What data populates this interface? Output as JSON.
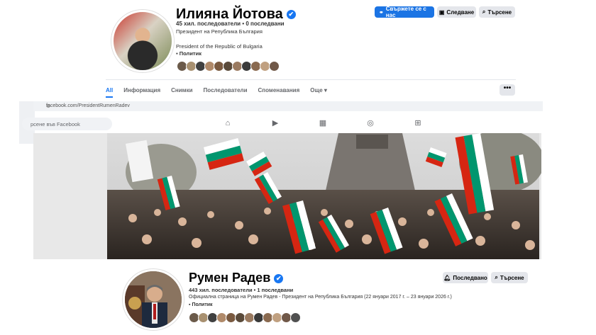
{
  "top_profile": {
    "name": "Илияна Йотова",
    "verified_mark": "✔",
    "stats": "45 хил. последователи • 0 последвани",
    "subtitle": "Президент на Република България",
    "description_en": "President of the Republic of Bulgaria",
    "category": "Политик",
    "buttons": {
      "contact": "Свържете се с нас",
      "follow": "Следване",
      "search": "Търсене"
    },
    "tabs": [
      "All",
      "Информация",
      "Снимки",
      "Последователи",
      "Споменавания",
      "Още"
    ],
    "more_icon": "•••",
    "follower_face_colors": [
      "#6b5a4a",
      "#a89070",
      "#404040",
      "#b08a6a",
      "#7a5a40",
      "#5a4a3a",
      "#9a7a60",
      "#3a3a3a",
      "#8a6a50",
      "#c0a080",
      "#705848"
    ]
  },
  "browser": {
    "url": "facebook.com/PresidentRumenRadev",
    "search_placeholder": "рсене във Facebook",
    "nav_icons": [
      "home-icon",
      "video-icon",
      "marketplace-icon",
      "groups-icon",
      "gaming-icon"
    ]
  },
  "bottom_profile": {
    "name": "Румен Радев",
    "verified_mark": "✔",
    "stats": "443 хил. последователи • 1 последвани",
    "subtitle": "Официална страница на Румен Радев - Президент на Република България (22 януари 2017 г. – 23 януари 2026 г.)",
    "category": "Политик",
    "buttons": {
      "following": "Последвано",
      "search": "Търсене"
    },
    "follower_face_colors": [
      "#6b5a4a",
      "#a89070",
      "#404040",
      "#b08a6a",
      "#7a5a40",
      "#5a4a3a",
      "#9a7a60",
      "#3a3a3a",
      "#8a6a50",
      "#c0a080",
      "#705848",
      "#505050"
    ]
  },
  "colors": {
    "accent": "#1877f2",
    "flag_white": "#ffffff",
    "flag_green": "#00966e",
    "flag_red": "#d62612"
  }
}
